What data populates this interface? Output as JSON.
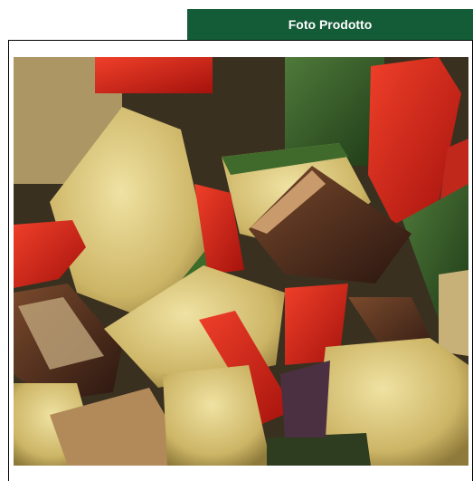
{
  "header": {
    "tab_label": "Foto Prodotto"
  },
  "photo": {
    "subject": "roasted-vegetables",
    "colors": {
      "accent": "#135c37",
      "zucchini": "#d8c27a",
      "pepper": "#d5251a",
      "eggplant": "#3a2418"
    }
  }
}
